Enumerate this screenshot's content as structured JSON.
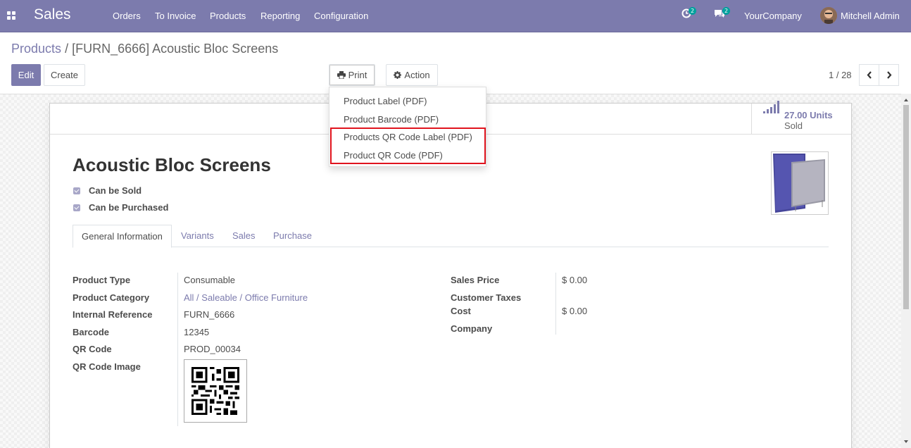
{
  "navbar": {
    "app_name": "Sales",
    "menus": [
      "Orders",
      "To Invoice",
      "Products",
      "Reporting",
      "Configuration"
    ],
    "activity_count": "2",
    "messages_count": "2",
    "company": "YourCompany",
    "user": "Mitchell Admin"
  },
  "breadcrumb": {
    "parent": "Products",
    "separator": "/",
    "current": "[FURN_6666] Acoustic Bloc Screens"
  },
  "buttons": {
    "edit": "Edit",
    "create": "Create",
    "print": "Print",
    "action": "Action"
  },
  "pager": {
    "value": "1 / 28"
  },
  "print_menu": {
    "items": [
      "Product Label (PDF)",
      "Product Barcode (PDF)",
      "Products QR Code Label (PDF)",
      "Product QR Code (PDF)"
    ]
  },
  "stat": {
    "value": "27.00 Units",
    "label": "Sold"
  },
  "product": {
    "name": "Acoustic Bloc Screens",
    "can_be_sold_label": "Can be Sold",
    "can_be_purchased_label": "Can be Purchased"
  },
  "tabs": [
    "General Information",
    "Variants",
    "Sales",
    "Purchase"
  ],
  "left_fields": {
    "product_type": {
      "label": "Product Type",
      "value": "Consumable"
    },
    "category": {
      "label": "Product Category",
      "value": "All / Saleable / Office Furniture"
    },
    "internal_ref": {
      "label": "Internal Reference",
      "value": "FURN_6666"
    },
    "barcode": {
      "label": "Barcode",
      "value": "12345"
    },
    "qr_code": {
      "label": "QR Code",
      "value": "PROD_00034"
    },
    "qr_image": {
      "label": "QR Code Image"
    }
  },
  "right_fields": {
    "sales_price": {
      "label": "Sales Price",
      "value": "$ 0.00"
    },
    "customer_taxes": {
      "label": "Customer Taxes",
      "value": ""
    },
    "cost": {
      "label": "Cost",
      "value": "$ 0.00"
    },
    "company": {
      "label": "Company",
      "value": ""
    }
  },
  "colors": {
    "brand": "#7c7bad",
    "highlight": "#e0141e"
  }
}
